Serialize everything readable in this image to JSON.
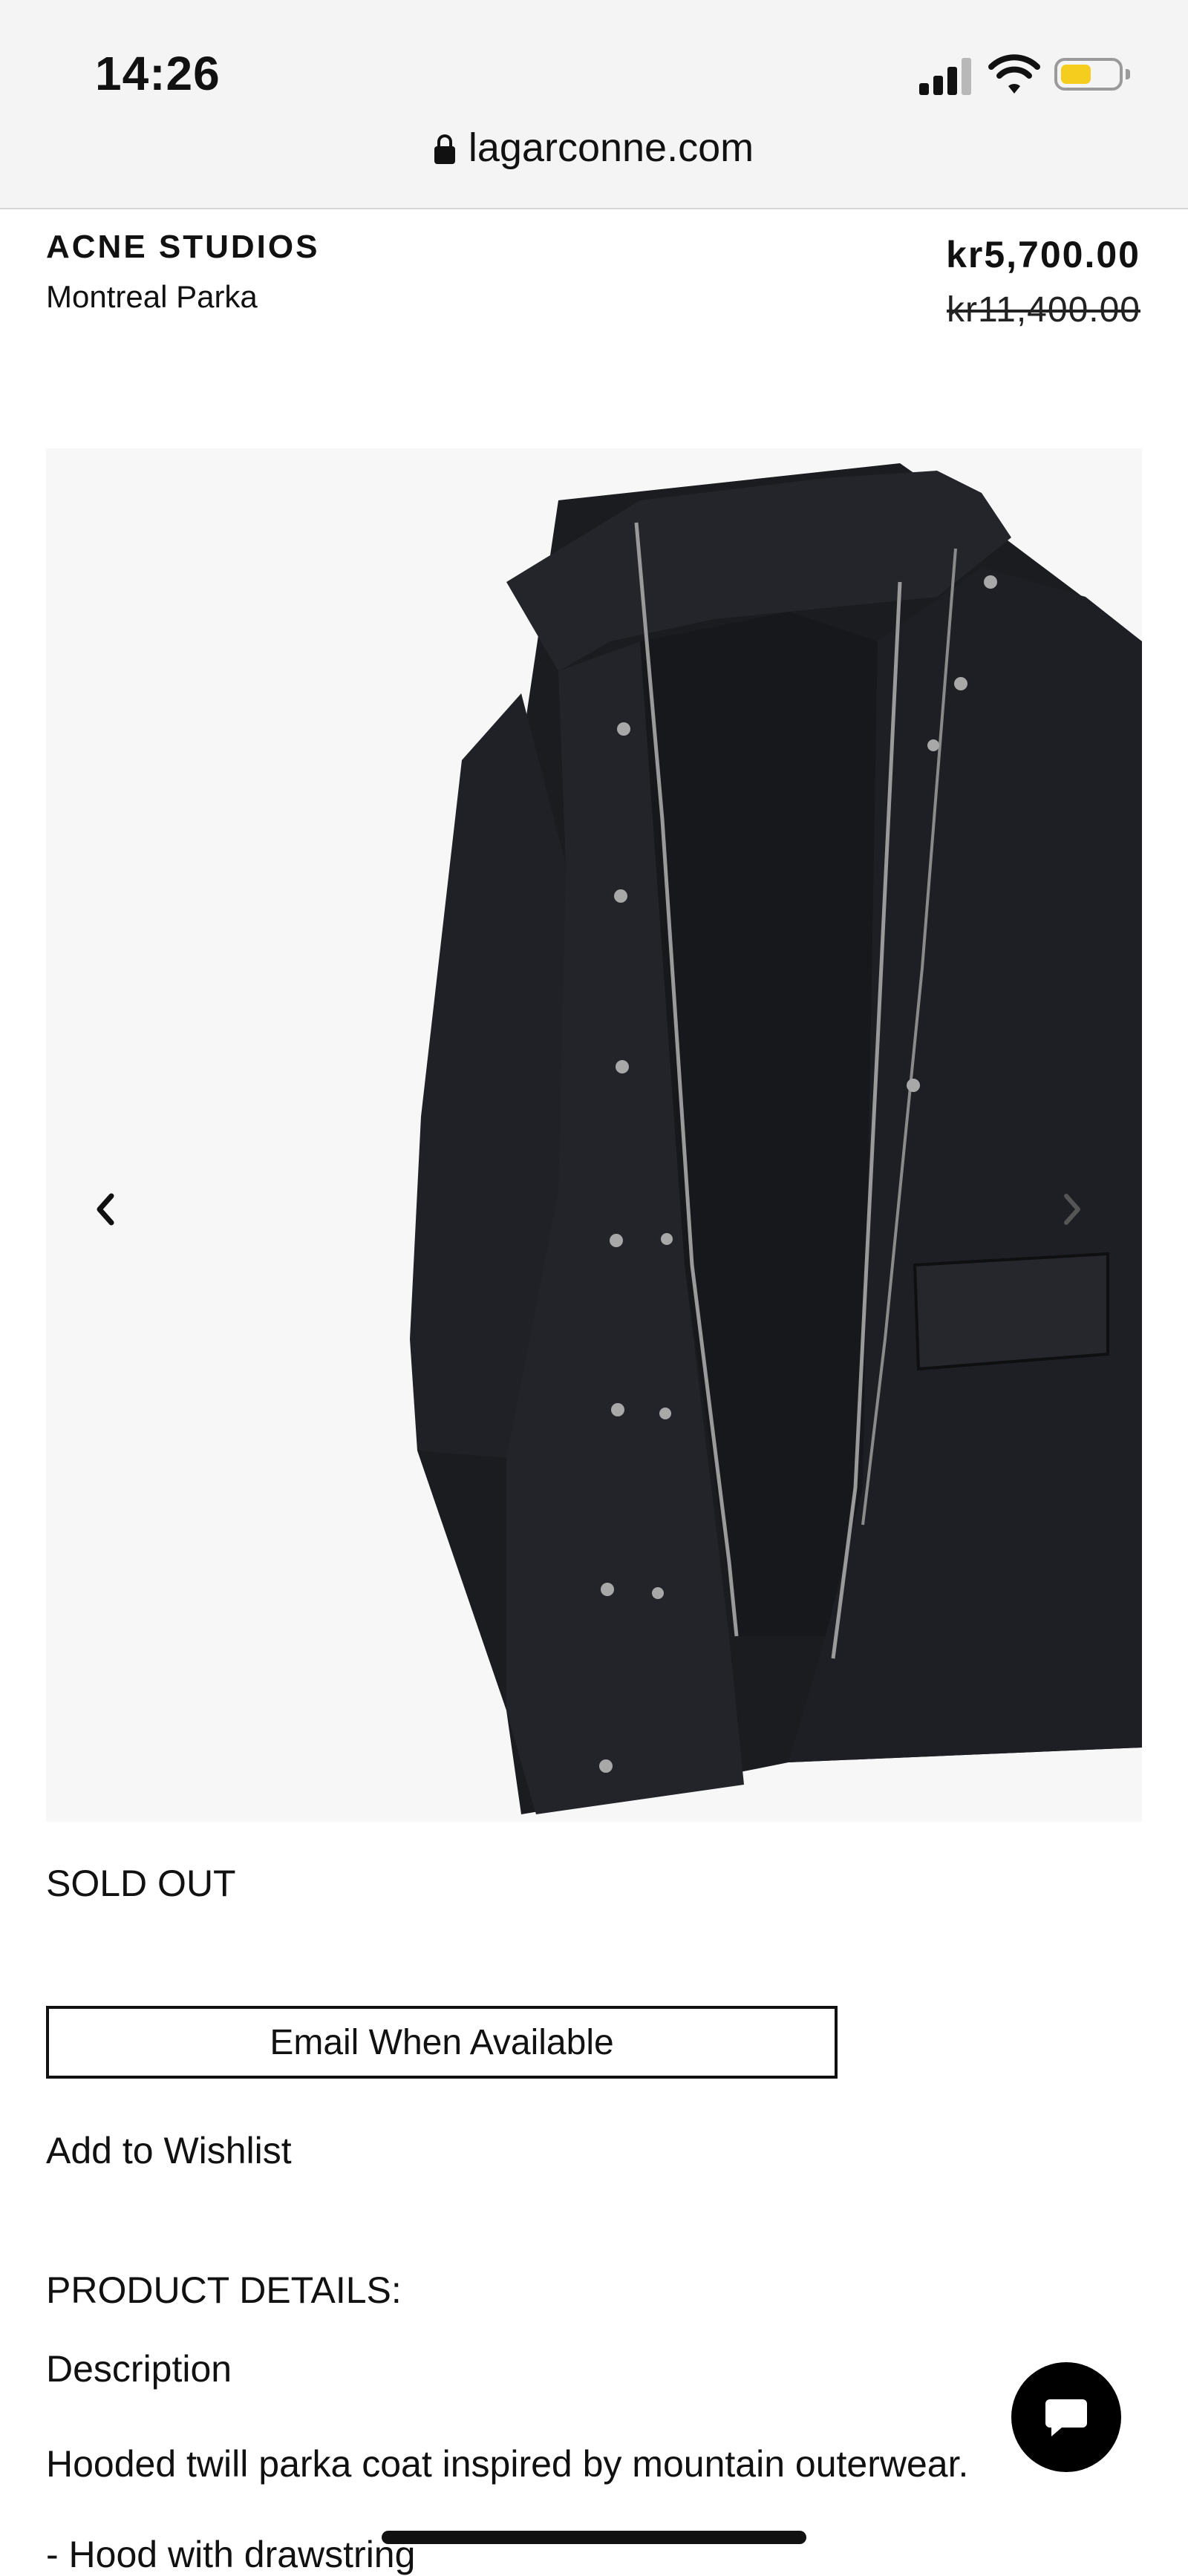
{
  "status_bar": {
    "time": "14:26",
    "signal_icon": "cellular-signal-icon",
    "wifi_icon": "wifi-icon",
    "battery_icon": "battery-icon",
    "battery_color": "#f4cd1f"
  },
  "browser": {
    "url": "lagarconne.com",
    "lock_icon": "lock-icon"
  },
  "product": {
    "brand": "ACNE STUDIOS",
    "name": "Montreal Parka",
    "price": "kr5,700.00",
    "original_price": "kr11,400.00"
  },
  "gallery": {
    "image_alt": "black hooded parka coat",
    "prev_icon": "chevron-left-icon",
    "next_icon": "chevron-right-icon"
  },
  "availability": {
    "status": "SOLD OUT",
    "email_button_label": "Email When Available",
    "wishlist_label": "Add to Wishlist"
  },
  "details": {
    "heading": "PRODUCT DETAILS:",
    "description_label": "Description",
    "description_text": "Hooded twill parka coat inspired by mountain outerwear.",
    "bullets": [
      "- Hood with drawstring"
    ]
  },
  "chat": {
    "icon": "chat-bubble-icon"
  }
}
